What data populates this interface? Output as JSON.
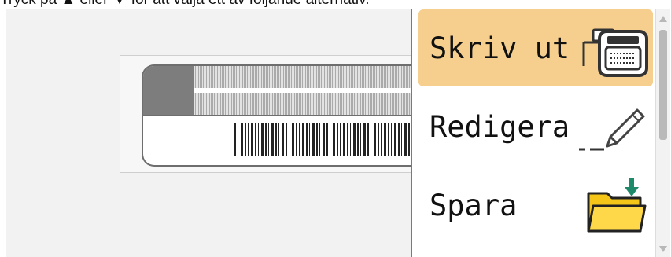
{
  "instruction": "Tryck på ▲ eller ▼ för att välja ett av följande alternativ.",
  "menu": {
    "items": [
      {
        "label": "Skriv ut",
        "icon": "printer-icon",
        "selected": true
      },
      {
        "label": "Redigera",
        "icon": "pencil-icon",
        "selected": false
      },
      {
        "label": "Spara",
        "icon": "folder-save-icon",
        "selected": false
      }
    ]
  },
  "colors": {
    "selected_bg": "#f6cf8e",
    "folder": "#f5c518",
    "arrow": "#1f8a6a"
  }
}
